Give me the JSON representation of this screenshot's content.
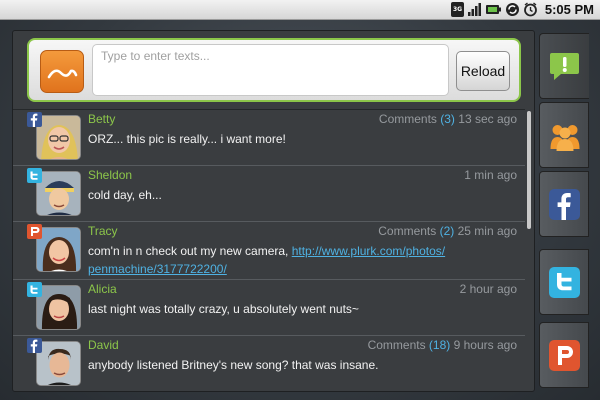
{
  "status_bar": {
    "network": "3G",
    "time": "5:05 PM",
    "icons": [
      "network-3g-icon",
      "signal-icon",
      "battery-icon",
      "sync-icon",
      "alarm-clock-icon"
    ]
  },
  "composer": {
    "placeholder": "Type to enter texts...",
    "value": "",
    "reload_label": "Reload",
    "accent": "#8cc64a"
  },
  "side_tabs": [
    {
      "id": "notifications",
      "icon": "exclamation-bubble-icon",
      "color": "#8cc64a",
      "active": true
    },
    {
      "id": "friends",
      "icon": "friends-group-icon",
      "color": "#f0992e",
      "active": false
    },
    {
      "id": "facebook",
      "icon": "facebook-icon",
      "color": "#3b5998",
      "active": false
    },
    {
      "id": "twitter",
      "icon": "twitter-icon",
      "color": "#33b3e0",
      "active": false
    },
    {
      "id": "plurk",
      "icon": "plurk-icon",
      "color": "#e0552f",
      "active": false
    }
  ],
  "posts": [
    {
      "name": "Betty",
      "source": "facebook",
      "source_icon": "facebook-icon",
      "comments_label": "Comments",
      "comments": "(3)",
      "time": "13 sec ago",
      "text": "ORZ... this pic is really... i want more!",
      "link": ""
    },
    {
      "name": "Sheldon",
      "source": "twitter",
      "source_icon": "twitter-icon",
      "comments_label": "",
      "comments": "",
      "time": "1 min ago",
      "text": "cold day, eh...",
      "link": ""
    },
    {
      "name": "Tracy",
      "source": "plurk",
      "source_icon": "plurk-icon",
      "comments_label": "Comments",
      "comments": "(2)",
      "time": "25 min ago",
      "text": "com'n in n check out my new camera, ",
      "link": "http://www.plurk.com/photos/ penmachine/3177722200/"
    },
    {
      "name": "Alicia",
      "source": "twitter",
      "source_icon": "twitter-icon",
      "comments_label": "",
      "comments": "",
      "time": "2 hour ago",
      "text": "last night was totally crazy, u absolutely went nuts~",
      "link": ""
    },
    {
      "name": "David",
      "source": "facebook",
      "source_icon": "facebook-icon",
      "comments_label": "Comments",
      "comments": "(18)",
      "time": "9 hours ago",
      "text": "anybody listened Britney's new song? that was insane.",
      "link": ""
    }
  ]
}
